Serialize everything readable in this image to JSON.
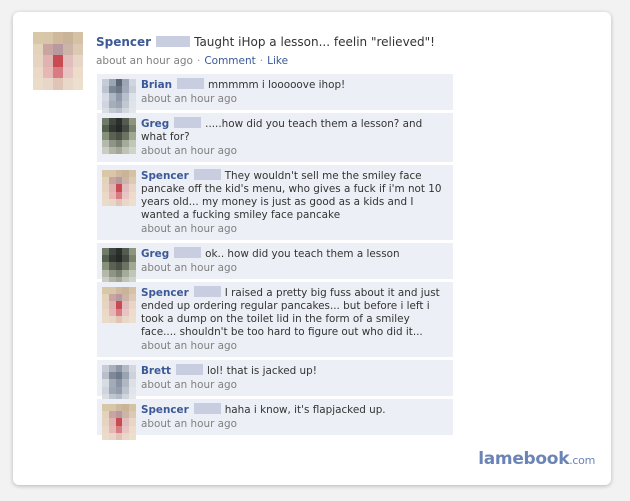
{
  "post": {
    "author": "Spencer",
    "status_text": "Taught iHop a lesson... feelin \"relieved\"!",
    "time": "about an hour ago",
    "separator": "·",
    "comment_link": "Comment",
    "like_link": "Like",
    "avatar_colors": [
      "#d9c8a8",
      "#d8c6ab",
      "#cfb89c",
      "#c9b49a",
      "#d5c2a5",
      "#e4d3bb",
      "#c9a4a0",
      "#b69aa0",
      "#cdb4a8",
      "#dcc9b4",
      "#e6d4c1",
      "#dfb3b1",
      "#c84b52",
      "#e2bdbd",
      "#e7d6c6",
      "#ead9c7",
      "#e7b7b5",
      "#d97b82",
      "#e9c4c4",
      "#eddcca",
      "#eadcc9",
      "#e8d6c8",
      "#e0c5b7",
      "#e9d8c8",
      "#ecdfcd"
    ]
  },
  "comments": [
    {
      "author": "Brian",
      "text": "mmmmm i looooove ihop!",
      "time": "about an hour ago",
      "avatar_colors": [
        "#c5ccd8",
        "#9aa5b5",
        "#5b6674",
        "#9ca6b4",
        "#d0d6df",
        "#bcc4d0",
        "#7b8796",
        "#6d7887",
        "#a1aabb",
        "#c8cfd9",
        "#d6dbe3",
        "#aeb6c4",
        "#8d98a8",
        "#b7c0cc",
        "#dde1e8",
        "#cfd5de",
        "#a4adba",
        "#9aa4b2",
        "#c1c8d3",
        "#e0e4ea",
        "#d9dee5",
        "#c2c9d3",
        "#b9c0cb",
        "#d2d8e0",
        "#e3e6ec"
      ]
    },
    {
      "author": "Greg",
      "text": ".....how did you teach them a lesson? and what for?",
      "time": "about an hour ago",
      "avatar_colors": [
        "#6f7a68",
        "#3e4740",
        "#2b302c",
        "#545c52",
        "#8d957f",
        "#56604f",
        "#313831",
        "#262a26",
        "#444b43",
        "#79836c",
        "#879078",
        "#596253",
        "#4a5248",
        "#6b7462",
        "#a0a892",
        "#b5b9ab",
        "#8f9584",
        "#7a8170",
        "#a5ab9a",
        "#c2c6b8",
        "#c9ccc0",
        "#b0b4a6",
        "#a1a697",
        "#bfc2b4",
        "#d0d3c8"
      ]
    },
    {
      "author": "Spencer",
      "text": "They wouldn't sell me the smiley face pancake off the kid's menu, who gives a fuck if i'm not 10 years old... my money is just as good as a kids and I wanted a fucking smiley face pancake",
      "time": "about an hour ago",
      "avatar_colors": [
        "#d9c8a8",
        "#d8c6ab",
        "#cfb89c",
        "#c9b49a",
        "#d5c2a5",
        "#e4d3bb",
        "#c9a4a0",
        "#b69aa0",
        "#cdb4a8",
        "#dcc9b4",
        "#e6d4c1",
        "#dfb3b1",
        "#c84b52",
        "#e2bdbd",
        "#e7d6c6",
        "#ead9c7",
        "#e7b7b5",
        "#d97b82",
        "#e9c4c4",
        "#eddcca",
        "#eadcc9",
        "#e8d6c8",
        "#e0c5b7",
        "#e9d8c8",
        "#ecdfcd"
      ]
    },
    {
      "author": "Greg",
      "text": "ok.. how did you teach them a lesson",
      "time": "about an hour ago",
      "avatar_colors": [
        "#6f7a68",
        "#3e4740",
        "#2b302c",
        "#545c52",
        "#8d957f",
        "#56604f",
        "#313831",
        "#262a26",
        "#444b43",
        "#79836c",
        "#879078",
        "#596253",
        "#4a5248",
        "#6b7462",
        "#a0a892",
        "#b5b9ab",
        "#8f9584",
        "#7a8170",
        "#a5ab9a",
        "#c2c6b8",
        "#c9ccc0",
        "#b0b4a6",
        "#a1a697",
        "#bfc2b4",
        "#d0d3c8"
      ]
    },
    {
      "author": "Spencer",
      "text": "I raised a pretty big fuss about it and just ended up ordering regular pancakes... but before i left i took a dump on the toilet lid in the form of a smiley face.... shouldn't be too hard to figure out who did it...",
      "time": "about an hour ago",
      "avatar_colors": [
        "#d9c8a8",
        "#d8c6ab",
        "#cfb89c",
        "#c9b49a",
        "#d5c2a5",
        "#e4d3bb",
        "#c9a4a0",
        "#b69aa0",
        "#cdb4a8",
        "#dcc9b4",
        "#e6d4c1",
        "#dfb3b1",
        "#c84b52",
        "#e2bdbd",
        "#e7d6c6",
        "#ead9c7",
        "#e7b7b5",
        "#d97b82",
        "#e9c4c4",
        "#eddcca",
        "#eadcc9",
        "#e8d6c8",
        "#e0c5b7",
        "#e9d8c8",
        "#ecdfcd"
      ]
    },
    {
      "author": "Brett",
      "text": "lol! that is jacked up!",
      "time": "about an hour ago",
      "avatar_colors": [
        "#c7ccd6",
        "#a9b0bd",
        "#8e97a6",
        "#b3bac6",
        "#d3d8e0",
        "#b8bfcb",
        "#7f8999",
        "#6f7a8b",
        "#9aa3b2",
        "#ccd1da",
        "#d7dbe2",
        "#a3abb9",
        "#8893a3",
        "#b0b8c4",
        "#dde0e6",
        "#cfd4dc",
        "#9ea7b5",
        "#929cab",
        "#bdc4cf",
        "#e1e4e9",
        "#dadee4",
        "#c0c6d0",
        "#b5bcc7",
        "#d1d6dd",
        "#e4e7eb"
      ]
    },
    {
      "author": "Spencer",
      "text": "haha i know, it's flapjacked up.",
      "time": "about an hour ago",
      "avatar_colors": [
        "#d9c8a8",
        "#d8c6ab",
        "#cfb89c",
        "#c9b49a",
        "#d5c2a5",
        "#e4d3bb",
        "#c9a4a0",
        "#b69aa0",
        "#cdb4a8",
        "#dcc9b4",
        "#e6d4c1",
        "#dfb3b1",
        "#c84b52",
        "#e2bdbd",
        "#e7d6c6",
        "#ead9c7",
        "#e7b7b5",
        "#d97b82",
        "#e9c4c4",
        "#eddcca",
        "#eadcc9",
        "#e8d6c8",
        "#e0c5b7",
        "#e9d8c8",
        "#ecdfcd"
      ]
    }
  ],
  "watermark": {
    "brand": "lamebook",
    "suffix": ".com"
  },
  "colors": {
    "name_link": "#3b5998",
    "comment_bg": "#eceff5",
    "redaction": "#c8cde0"
  }
}
